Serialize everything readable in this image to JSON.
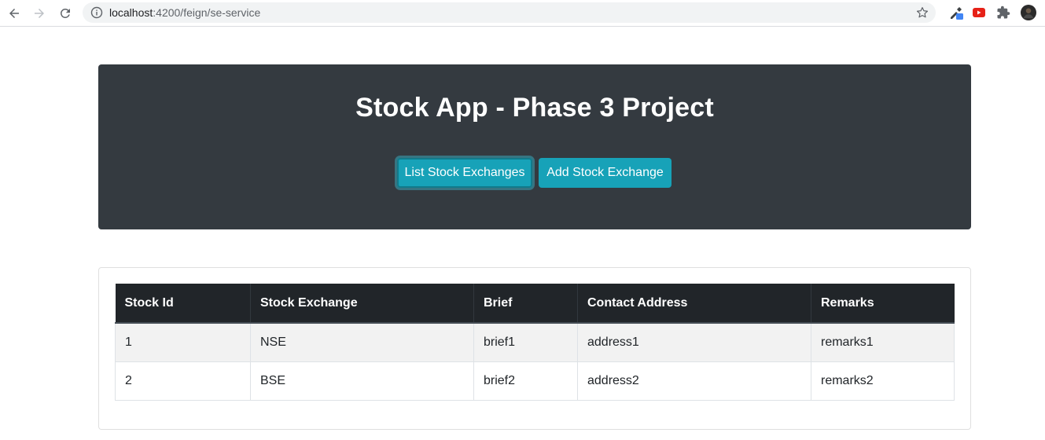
{
  "browser": {
    "url_host": "localhost",
    "url_path": ":4200/feign/se-service"
  },
  "header": {
    "title": "Stock App - Phase 3 Project",
    "buttons": [
      {
        "label": "List Stock Exchanges"
      },
      {
        "label": "Add Stock Exchange"
      }
    ]
  },
  "table": {
    "columns": [
      "Stock Id",
      "Stock Exchange",
      "Brief",
      "Contact Address",
      "Remarks"
    ],
    "rows": [
      [
        "1",
        "NSE",
        "brief1",
        "address1",
        "remarks1"
      ],
      [
        "2",
        "BSE",
        "brief2",
        "address2",
        "remarks2"
      ]
    ]
  },
  "colors": {
    "jumbotron_bg": "#343a40",
    "button_info": "#17a2b8",
    "table_head_bg": "#212529"
  }
}
